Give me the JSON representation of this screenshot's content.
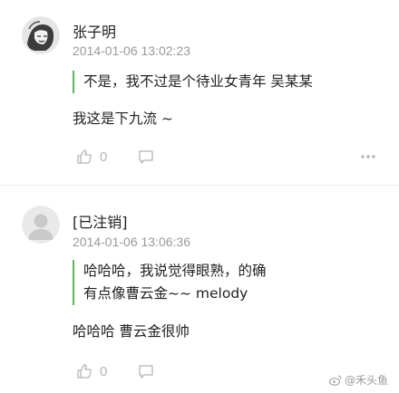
{
  "comments": [
    {
      "author": "张子明",
      "time": "2014-01-06 13:02:23",
      "quote": "不是，我不过是个待业女青年 吴某某",
      "text": "我这是下九流 ~",
      "likes": "0",
      "avatar": "sketch-avatar-icon"
    },
    {
      "author": "[已注销]",
      "time": "2014-01-06 13:06:36",
      "quote": "哈哈哈，我说觉得眼熟，的确有点像曹云金~~ melody",
      "text": "哈哈哈 曹云金很帅",
      "likes": "0",
      "avatar": "default-avatar-icon"
    }
  ],
  "watermark": "@禾头鱼",
  "colors": {
    "quote_bar": "#5cb85c",
    "meta_text": "#9a9a9a",
    "icon": "#b5b5b5"
  }
}
